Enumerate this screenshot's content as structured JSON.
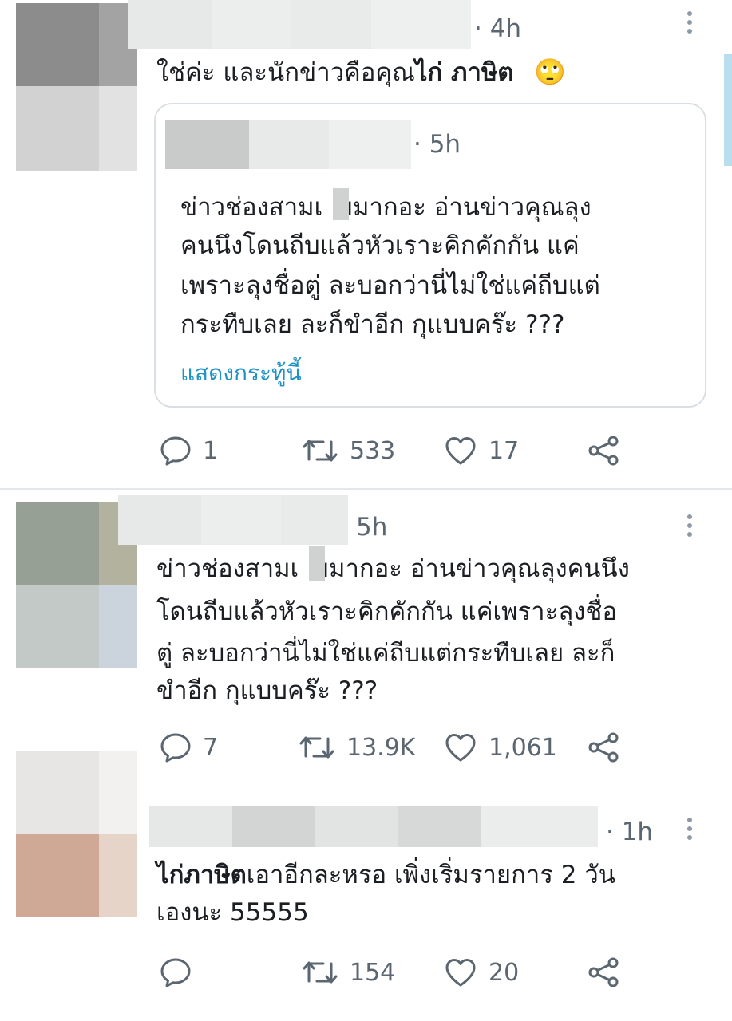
{
  "tweets": [
    {
      "time": "· 4h",
      "text_plain": "ใช่ค่ะ และนักข่าวคือคุณ",
      "text_bold": "ไก่ ภาษิต",
      "emoji": "🙄",
      "quote": {
        "time": "· 5h",
        "lines": [
          "ข่าวช่องสามเ  ยมากอะ อ่านข่าวคุณลุง",
          "คนนึงโดนถีบแล้วหัวเราะคิกคักกัน แค่",
          "เพราะลุงชื่อตู่ ละบอกว่านี่ไม่ใช่แค่ถีบแต่",
          "กระทืบเลย ละก็ขำอีก กุแบบคร๊ะ ???"
        ],
        "show_thread": "แสดงกระทู้นี้"
      },
      "actions": {
        "replies": "1",
        "retweets": "533",
        "likes": "17"
      }
    },
    {
      "time": "5h",
      "lines": [
        "ข่าวช่องสามเ  ยมากอะ อ่านข่าวคุณลุงคนนึง",
        "โดนถีบแล้วหัวเราะคิกคักกัน แค่เพราะลุงชื่อ",
        "ตู่ ละบอกว่านี่ไม่ใช่แค่ถีบแต่กระทืบเลย ละก็",
        "ขำอีก กุแบบคร๊ะ ???"
      ],
      "actions": {
        "replies": "7",
        "retweets": "13.9K",
        "likes": "1,061"
      }
    },
    {
      "time": "· 1h",
      "text_bold": "ไก่ภาษิต",
      "line1_rest": "เอาอีกละหรอ เพิ่งเริ่มรายการ 2 วัน",
      "line2": "เองนะ 55555",
      "actions": {
        "replies": "",
        "retweets": "154",
        "likes": "20"
      }
    }
  ],
  "icons": {
    "reply": "speech-bubble-icon",
    "retweet": "retweet-arrows-icon",
    "like": "heart-icon",
    "share": "share-nodes-icon",
    "more": "vertical-dots-icon"
  },
  "colors": {
    "text": "#1b1e22",
    "muted": "#5b6670",
    "link": "#1c93c4",
    "border": "#d9dfe4"
  }
}
